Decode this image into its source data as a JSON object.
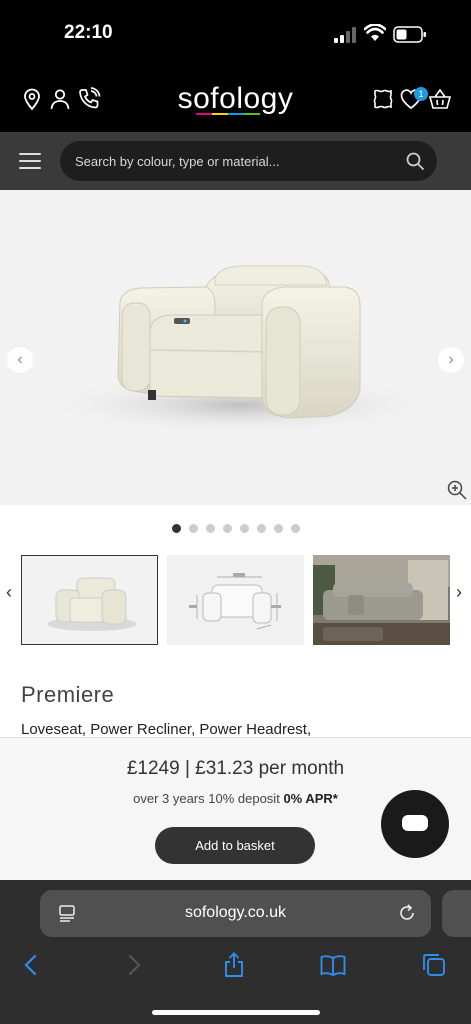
{
  "status": {
    "time": "22:10"
  },
  "header": {
    "logo": "sofology",
    "wishlist_count": "1",
    "icons": [
      "location-icon",
      "account-icon",
      "phone-icon",
      "swatch-icon",
      "heart-icon",
      "basket-icon"
    ]
  },
  "search": {
    "placeholder": "Search by colour, type or material..."
  },
  "gallery": {
    "total_images": 8,
    "active_index": 0
  },
  "product": {
    "name": "Premiere",
    "subtitle": "Loveseat, Power Recliner, Power Headrest,",
    "price_line": "£1249 | £31.23 per month",
    "terms_prefix": "over 3 years 10% deposit",
    "terms_bold": "0% APR*",
    "add_to_basket": "Add to basket"
  },
  "browser": {
    "url": "sofology.co.uk"
  },
  "colors": {
    "accent": "#1b9be0",
    "header_bg": "#000000",
    "search_row_bg": "#3a3a3a",
    "button_bg": "#333333"
  }
}
